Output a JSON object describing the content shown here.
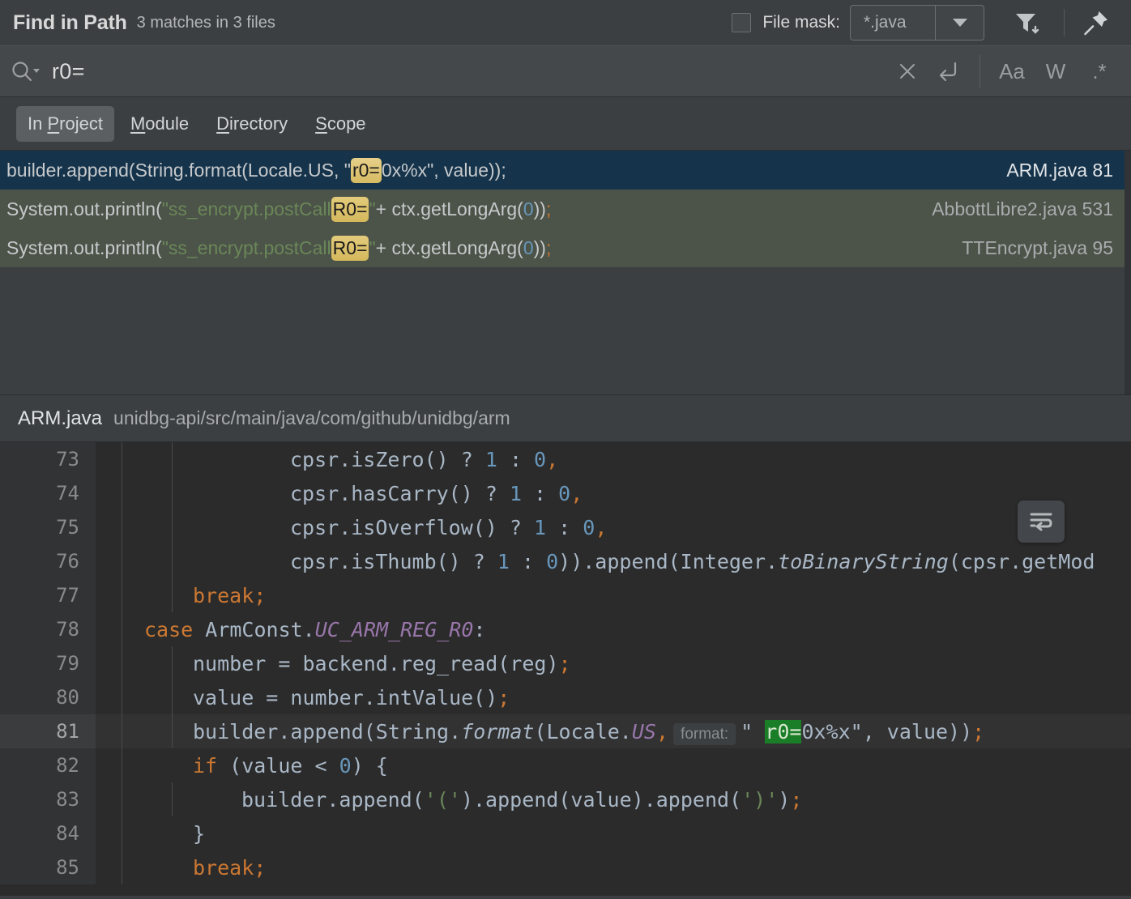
{
  "header": {
    "title": "Find in Path",
    "subtitle": "3 matches in 3 files",
    "file_mask_label": "File mask:",
    "file_mask_value": "*.java",
    "file_mask_checked": false,
    "filter_icon": "filter-icon",
    "pin_icon": "pin-icon"
  },
  "search": {
    "value": "r0=",
    "icon": "search-icon",
    "actions": {
      "clear": "×",
      "newline": "↵",
      "match_case": "Aa",
      "words": "W",
      "regex": ".*"
    }
  },
  "scope_tabs": [
    {
      "label_pre": "In ",
      "mnemonic": "P",
      "label_post": "roject",
      "active": true
    },
    {
      "label_pre": "",
      "mnemonic": "M",
      "label_post": "odule",
      "active": false
    },
    {
      "label_pre": "",
      "mnemonic": "D",
      "label_post": "irectory",
      "active": false
    },
    {
      "label_pre": "",
      "mnemonic": "S",
      "label_post": "cope",
      "active": false
    }
  ],
  "results": [
    {
      "selected": false,
      "file": "TTEncrypt.java 95",
      "parts": [
        {
          "t": "System.out.println(",
          "c": "plain"
        },
        {
          "t": "\"ss_encrypt.postCall ",
          "c": "string"
        },
        {
          "t": "R0=",
          "c": "match"
        },
        {
          "t": "\"",
          "c": "string"
        },
        {
          "t": " + ctx.getLongArg(",
          "c": "plain"
        },
        {
          "t": "0",
          "c": "number"
        },
        {
          "t": "))",
          "c": "plain"
        },
        {
          "t": ";",
          "c": "semi"
        }
      ]
    },
    {
      "selected": false,
      "file": "AbbottLibre2.java 531",
      "parts": [
        {
          "t": "System.out.println(",
          "c": "plain"
        },
        {
          "t": "\"ss_encrypt.postCall ",
          "c": "string"
        },
        {
          "t": "R0=",
          "c": "match"
        },
        {
          "t": "\"",
          "c": "string"
        },
        {
          "t": " + ctx.getLongArg(",
          "c": "plain"
        },
        {
          "t": "0",
          "c": "number"
        },
        {
          "t": "))",
          "c": "plain"
        },
        {
          "t": ";",
          "c": "semi"
        }
      ]
    },
    {
      "selected": true,
      "file": "ARM.java 81",
      "parts": [
        {
          "t": "builder.append(String.format(Locale.US, \" ",
          "c": "plain"
        },
        {
          "t": "r0=",
          "c": "match"
        },
        {
          "t": "0x%x\", value));",
          "c": "plain"
        }
      ]
    }
  ],
  "preview": {
    "file_name": "ARM.java",
    "file_dir": "unidbg-api/src/main/java/com/github/unidbg/arm",
    "wrap_button_icon": "soft-wrap-icon",
    "lines": [
      {
        "num": "73",
        "caret": false,
        "guides": 2,
        "indent": 16,
        "tokens": [
          {
            "t": "cpsr.isZero() ? ",
            "c": "p"
          },
          {
            "t": "1",
            "c": "n"
          },
          {
            "t": " : ",
            "c": "p"
          },
          {
            "t": "0",
            "c": "n"
          },
          {
            "t": ",",
            "c": "k"
          }
        ]
      },
      {
        "num": "74",
        "caret": false,
        "guides": 2,
        "indent": 16,
        "tokens": [
          {
            "t": "cpsr.hasCarry() ? ",
            "c": "p"
          },
          {
            "t": "1",
            "c": "n"
          },
          {
            "t": " : ",
            "c": "p"
          },
          {
            "t": "0",
            "c": "n"
          },
          {
            "t": ",",
            "c": "k"
          }
        ]
      },
      {
        "num": "75",
        "caret": false,
        "guides": 2,
        "indent": 16,
        "tokens": [
          {
            "t": "cpsr.isOverflow() ? ",
            "c": "p"
          },
          {
            "t": "1",
            "c": "n"
          },
          {
            "t": " : ",
            "c": "p"
          },
          {
            "t": "0",
            "c": "n"
          },
          {
            "t": ",",
            "c": "k"
          }
        ]
      },
      {
        "num": "76",
        "caret": false,
        "guides": 2,
        "indent": 16,
        "tokens": [
          {
            "t": "cpsr.isThumb() ? ",
            "c": "p"
          },
          {
            "t": "1",
            "c": "n"
          },
          {
            "t": " : ",
            "c": "p"
          },
          {
            "t": "0",
            "c": "n"
          },
          {
            "t": ")).append(Integer.",
            "c": "p"
          },
          {
            "t": "toBinaryString",
            "c": "mi"
          },
          {
            "t": "(cpsr.getMod",
            "c": "p"
          }
        ]
      },
      {
        "num": "77",
        "caret": false,
        "guides": 2,
        "indent": 8,
        "tokens": [
          {
            "t": "break",
            "c": "k"
          },
          {
            "t": ";",
            "c": "k"
          }
        ]
      },
      {
        "num": "78",
        "caret": false,
        "guides": 1,
        "indent": 4,
        "tokens": [
          {
            "t": "case ",
            "c": "k"
          },
          {
            "t": "ArmConst.",
            "c": "p"
          },
          {
            "t": "UC_ARM_REG_R0",
            "c": "st"
          },
          {
            "t": ":",
            "c": "p"
          }
        ]
      },
      {
        "num": "79",
        "caret": false,
        "guides": 2,
        "indent": 8,
        "tokens": [
          {
            "t": "number = backend.reg_read(reg)",
            "c": "p"
          },
          {
            "t": ";",
            "c": "k"
          }
        ]
      },
      {
        "num": "80",
        "caret": false,
        "guides": 2,
        "indent": 8,
        "tokens": [
          {
            "t": "value = number.intValue()",
            "c": "p"
          },
          {
            "t": ";",
            "c": "k"
          }
        ]
      },
      {
        "num": "81",
        "caret": true,
        "guides": 2,
        "indent": 8,
        "tokens": [
          {
            "t": "builder.append(String.",
            "c": "p"
          },
          {
            "t": "format",
            "c": "mi"
          },
          {
            "t": "(Locale.",
            "c": "p"
          },
          {
            "t": "US",
            "c": "st"
          },
          {
            "t": ",",
            "c": "k"
          },
          {
            "t": "format:",
            "c": "hint"
          },
          {
            "t": "\" ",
            "c": "p"
          },
          {
            "t": "r0=",
            "c": "green"
          },
          {
            "t": "0x%x\", value))",
            "c": "p"
          },
          {
            "t": ";",
            "c": "k"
          }
        ]
      },
      {
        "num": "82",
        "caret": false,
        "guides": 1,
        "indent": 8,
        "tokens": [
          {
            "t": "if ",
            "c": "k"
          },
          {
            "t": "(value < ",
            "c": "p"
          },
          {
            "t": "0",
            "c": "n"
          },
          {
            "t": ") {",
            "c": "p"
          }
        ]
      },
      {
        "num": "83",
        "caret": false,
        "guides": 2,
        "indent": 12,
        "tokens": [
          {
            "t": "builder.append(",
            "c": "p"
          },
          {
            "t": "'('",
            "c": "s"
          },
          {
            "t": ").append(value).append(",
            "c": "p"
          },
          {
            "t": "')'",
            "c": "s"
          },
          {
            "t": ")",
            "c": "p"
          },
          {
            "t": ";",
            "c": "k"
          }
        ]
      },
      {
        "num": "84",
        "caret": false,
        "guides": 1,
        "indent": 8,
        "tokens": [
          {
            "t": "}",
            "c": "p"
          }
        ]
      },
      {
        "num": "85",
        "caret": false,
        "guides": 1,
        "indent": 8,
        "tokens": [
          {
            "t": "break",
            "c": "k"
          },
          {
            "t": ";",
            "c": "k"
          }
        ]
      }
    ]
  },
  "colors": {
    "panel_bg": "#3c3f41",
    "editor_bg": "#2b2b2b",
    "selected_row": "#15334b",
    "hit_row": "#4c5348",
    "match_highlight": "#d4b85c",
    "usage_highlight": "#1a7d27",
    "keyword": "#cc7832",
    "number": "#6897bb",
    "string": "#6a8759",
    "static_field": "#9876aa"
  }
}
